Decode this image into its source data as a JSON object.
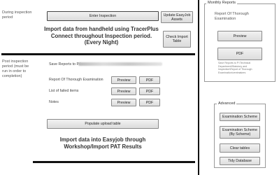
{
  "inspection": {
    "label_lines": [
      "During inspection",
      "period"
    ],
    "enter_button": "Enter Inspection",
    "update_button_lines": [
      "Update EasyJob",
      "Assets"
    ],
    "import_text_lines": [
      "Import data from handheld using TracerPlus",
      "Connect throughout Inspection period.",
      "(Every Night)"
    ],
    "check_button_lines": [
      "Check Import",
      "Table"
    ]
  },
  "post": {
    "label_lines": [
      "Post inspection",
      "period (must be",
      "run in order to",
      "completion)"
    ],
    "save_reports_label": "Save Reports to P:\\",
    "rows": [
      {
        "label": "Report Of Thorough Examination",
        "preview": "Preview",
        "pdf": "PDF"
      },
      {
        "label": "List of failed items",
        "preview": "Preview",
        "pdf": "PDF"
      },
      {
        "label": "Notes",
        "preview": "Preview",
        "pdf": "PDF"
      }
    ],
    "populate_button": "Populate upload table",
    "import_text_lines": [
      "Import data into Easyjob through",
      "Workshop/Import PAT Results"
    ]
  },
  "monthly": {
    "title": "Monthly Reports",
    "report_lines": [
      "Report Of Thorough",
      "Examination"
    ],
    "preview_button": "Preview",
    "pdf_button": "PDF",
    "note_lines": [
      "Save Reports to P:\\Technical",
      "Department\\Statutory and",
      "Inspection\\Report of Thorough",
      "Examination\\ventmakers"
    ]
  },
  "advanced": {
    "title": "Advanced",
    "buttons": [
      {
        "lines": [
          "Examination Scheme"
        ]
      },
      {
        "lines": [
          "Examination Scheme",
          "(By Scheme)"
        ]
      },
      {
        "lines": [
          "Clear tables"
        ]
      },
      {
        "lines": [
          "Tidy Database"
        ]
      }
    ]
  }
}
